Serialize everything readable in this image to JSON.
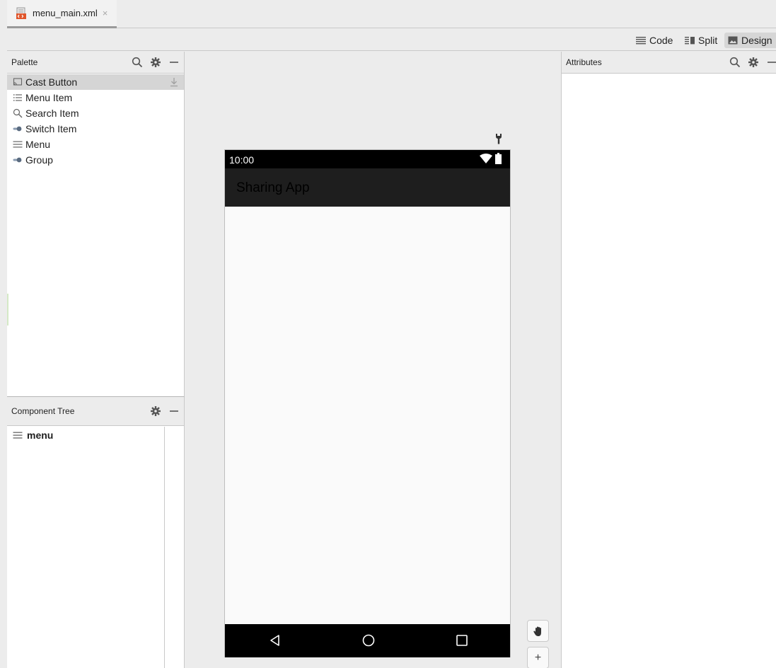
{
  "file_tab": {
    "name": "menu_main.xml",
    "close": "×"
  },
  "toolbar": {
    "code_label": "Code",
    "split_label": "Split",
    "design_label": "Design"
  },
  "palette": {
    "title": "Palette",
    "items": [
      {
        "label": "Cast Button",
        "icon": "cast-icon",
        "selected": true
      },
      {
        "label": "Menu Item",
        "icon": "menu-item-icon"
      },
      {
        "label": "Search Item",
        "icon": "search-icon"
      },
      {
        "label": "Switch Item",
        "icon": "switch-icon"
      },
      {
        "label": "Menu",
        "icon": "hamburger-icon"
      },
      {
        "label": "Group",
        "icon": "group-icon"
      }
    ]
  },
  "component_tree": {
    "title": "Component Tree",
    "items": [
      {
        "label": "menu",
        "icon": "hamburger-icon"
      }
    ]
  },
  "attributes": {
    "title": "Attributes"
  },
  "device": {
    "status_time": "10:00",
    "app_title": "Sharing App"
  },
  "canvas": {
    "zoom_in_label": "+"
  },
  "colors": {
    "status_bar": "#000000",
    "app_bar": "#1e1e1e",
    "app_title": "#000000",
    "screen": "#fafafa",
    "selected_row": "#d5d5d5",
    "ide_chrome": "#ececec"
  }
}
